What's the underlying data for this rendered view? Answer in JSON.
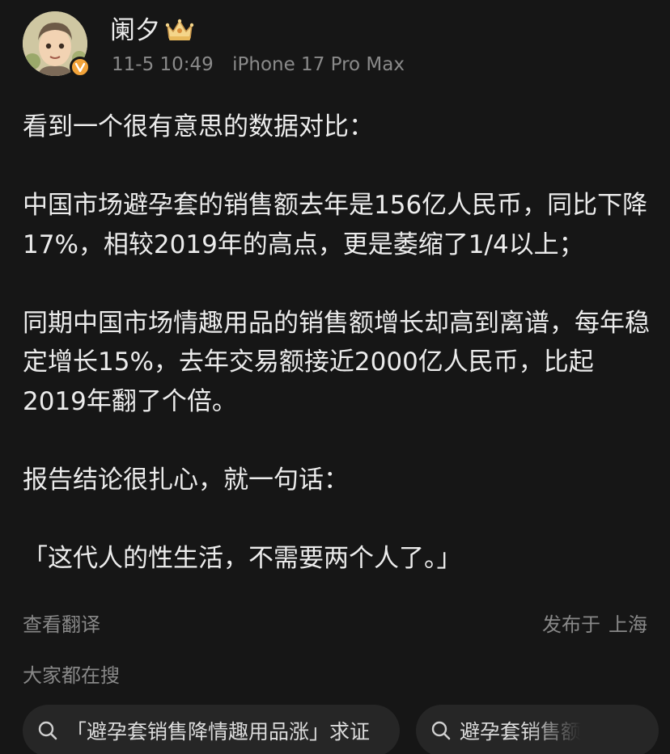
{
  "post": {
    "username": "阑夕",
    "timestamp": "11-5 10:49",
    "device": "iPhone 17 Pro Max",
    "paragraphs": [
      "看到一个很有意思的数据对比：",
      "中国市场避孕套的销售额去年是156亿人民币，同比下降17%，相较2019年的高点，更是萎缩了1/4以上；",
      "同期中国市场情趣用品的销售额增长却高到离谱，每年稳定增长15%，去年交易额接近2000亿人民币，比起2019年翻了个倍。",
      "报告结论很扎心，就一句话：",
      "「这代人的性生活，不需要两个人了。」"
    ],
    "translate_label": "查看翻译",
    "location_prefix": "发布于",
    "location": "上海"
  },
  "search": {
    "heading": "大家都在搜",
    "chips": [
      "「避孕套销售降情趣用品涨」求证",
      "避孕套销售额"
    ]
  },
  "icons": {
    "verified": "verified-badge-icon",
    "crown": "crown-icon",
    "search": "search-icon"
  },
  "colors": {
    "background": "#161616",
    "text": "#ececec",
    "secondary": "#888888",
    "chip_bg": "#262626",
    "badge": "#f2a33a"
  }
}
